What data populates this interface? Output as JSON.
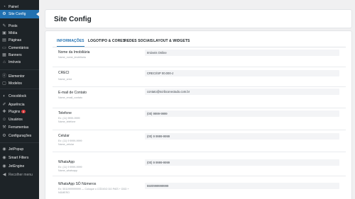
{
  "sidebar": {
    "items": [
      {
        "label": "Painel",
        "icon": "dashboard-icon"
      },
      {
        "label": "Site Config",
        "icon": "gear-icon"
      },
      {
        "label": "Posts",
        "icon": "pin-icon"
      },
      {
        "label": "Mídia",
        "icon": "media-icon"
      },
      {
        "label": "Páginas",
        "icon": "page-icon"
      },
      {
        "label": "Comentários",
        "icon": "comment-icon"
      },
      {
        "label": "Banners",
        "icon": "banner-icon"
      },
      {
        "label": "Imóveis",
        "icon": "house-icon"
      },
      {
        "label": "Elementor",
        "icon": "elementor-icon"
      },
      {
        "label": "Modelos",
        "icon": "template-icon"
      },
      {
        "label": "Crocoblock",
        "icon": "crocoblock-icon"
      },
      {
        "label": "Aparência",
        "icon": "brush-icon"
      },
      {
        "label": "Plugins",
        "icon": "plugin-icon",
        "badge": "4"
      },
      {
        "label": "Usuários",
        "icon": "user-icon"
      },
      {
        "label": "Ferramentas",
        "icon": "wrench-icon"
      },
      {
        "label": "Configurações",
        "icon": "settings-icon"
      },
      {
        "label": "JetPopup",
        "icon": "jetpopup-icon"
      },
      {
        "label": "Smart Filters",
        "icon": "filter-icon"
      },
      {
        "label": "JetEngine",
        "icon": "jetengine-icon"
      },
      {
        "label": "Recolher menu",
        "icon": "collapse-icon"
      }
    ]
  },
  "header": {
    "title": "Site Config"
  },
  "tabs": [
    "INFORMAÇÕES",
    "LOGOTIPO & CORES",
    "REDES SOCIAIS",
    "LAYOUT & WIDGETS"
  ],
  "fields": [
    {
      "label": "Nome da Imobiliária",
      "desc": "Name_nome_imobiliaria",
      "value": "Imóveis Online"
    },
    {
      "label": "CRECI",
      "desc": "Name_creci",
      "value": "CRECI/SP 00.000-J"
    },
    {
      "label": "E-mail de Contato",
      "desc": "Name_email_contato",
      "value": "contato@scribconectado.com.br"
    },
    {
      "label": "Telefone",
      "desc": "Ex: (11) 9999-9999\nName_telefone",
      "value": "(00) 9999-9999"
    },
    {
      "label": "Celular",
      "desc": "Ex: (11) 9 9999-9999\nName_celular",
      "value": "(00) 9 9999-9999"
    },
    {
      "label": "WhatsApp",
      "desc": "Ex: (11) 9 9999-9999\nName_whatsapp",
      "value": "(00) 9 9999-9999"
    },
    {
      "label": "WhatsApp SÓ Números",
      "desc": "Ex: 5511999999999 — Coloque o CÓDIGO DO PAÍS + DDD + NÚMERO",
      "value": "5500999999999"
    }
  ]
}
